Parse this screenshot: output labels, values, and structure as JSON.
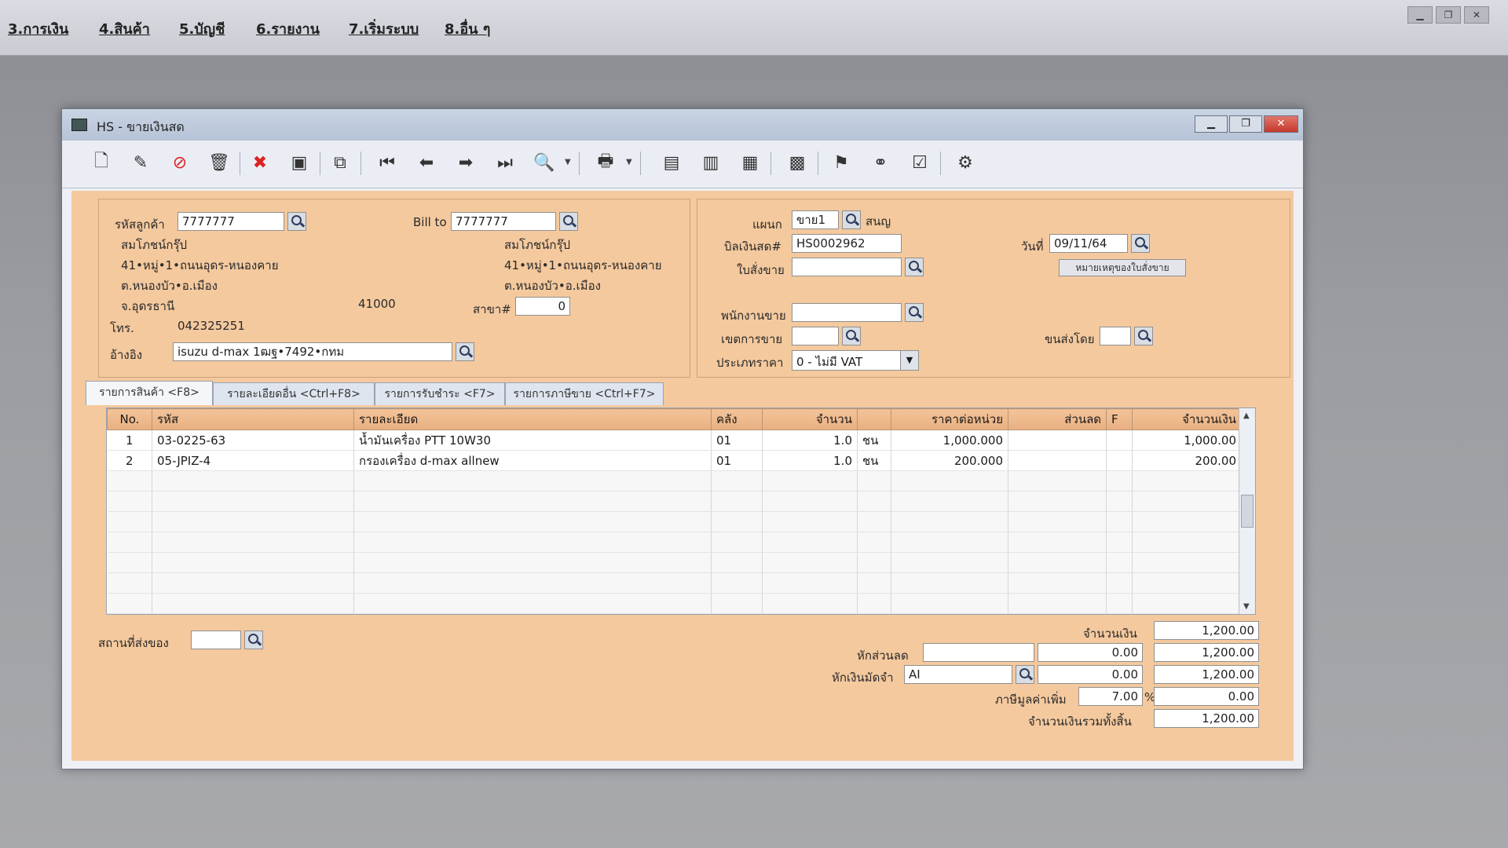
{
  "menu": [
    "3.การเงิน",
    "4.สินค้า",
    "5.บัญชี",
    "6.รายงาน",
    "7.เริ่มระบบ",
    "8.อื่น ๆ"
  ],
  "window": {
    "title": "HS - ขายเงินสด"
  },
  "customer": {
    "code_label": "รหัสลูกค้า",
    "code": "7777777",
    "name": "สมโภชน์กรุ๊ป",
    "addr1": "41•หมู่•1•ถนนอุดร-หนองคาย",
    "addr2": "ต.หนองบัว•อ.เมือง",
    "addr3": "จ.อุดรธานี",
    "zip": "41000",
    "tel_label": "โทร.",
    "tel": "042325251",
    "ref_label": "อ้างอิง",
    "ref": "isuzu d-max 1ฒฐ•7492•กทม"
  },
  "billto": {
    "label": "Bill to",
    "code": "7777777",
    "name": "สมโภชน์กรุ๊ป",
    "addr1": "41•หมู่•1•ถนนอุดร-หนองคาย",
    "addr2": "ต.หนองบัว•อ.เมือง",
    "branch_label": "สาขา#",
    "branch": "0"
  },
  "doc": {
    "dept_label": "แผนก",
    "dept": "ขาย1",
    "dept_name": "สนญ",
    "bill_label": "บิลเงินสด#",
    "bill": "HS0002962",
    "date_label": "วันที่",
    "date": "09/11/64",
    "so_label": "ใบสั่งขาย",
    "so": "",
    "so_note_btn": "หมายเหตุของใบสั่งขาย",
    "salesman_label": "พนักงานขาย",
    "salesman": "",
    "area_label": "เขตการขาย",
    "area": "",
    "ship_label": "ขนส่งโดย",
    "ship": "",
    "price_type_label": "ประเภทราคา",
    "price_type": "0 - ไม่มี VAT"
  },
  "tabs": [
    "รายการสินค้า <F8>",
    "รายละเอียดอื่น <Ctrl+F8>",
    "รายการรับชำระ <F7>",
    "รายการภาษีขาย <Ctrl+F7>"
  ],
  "grid": {
    "headers": [
      "No.",
      "รหัส",
      "รายละเอียด",
      "คลัง",
      "จำนวน",
      "",
      "ราคาต่อหน่วย",
      "ส่วนลด",
      "F",
      "จำนวนเงิน"
    ],
    "rows": [
      [
        "1",
        "03-0225-63",
        "น้ำมันเครื่อง PTT 10W30",
        "01",
        "1.0",
        "ชน",
        "1,000.000",
        "",
        "",
        "1,000.00"
      ],
      [
        "2",
        "05-JPIZ-4",
        "กรองเครื่อง d-max allnew",
        "01",
        "1.0",
        "ชน",
        "200.000",
        "",
        "",
        "200.00"
      ]
    ]
  },
  "footer": {
    "delivery_label": "สถานที่ส่งของ",
    "delivery": "",
    "amount_label": "จำนวนเงิน",
    "amount": "1,200.00",
    "discount_label": "หักส่วนลด",
    "discount_text": "",
    "discount_val": "0.00",
    "after_discount": "1,200.00",
    "deposit_label": "หักเงินมัดจำ",
    "deposit_text": "AI",
    "deposit_val": "0.00",
    "after_deposit": "1,200.00",
    "vat_label": "ภาษีมูลค่าเพิ่ม",
    "vat_rate": "7.00",
    "vat_pct": "%",
    "vat_amount": "0.00",
    "total_label": "จำนวนเงินรวมทั้งสิ้น",
    "total": "1,200.00"
  }
}
